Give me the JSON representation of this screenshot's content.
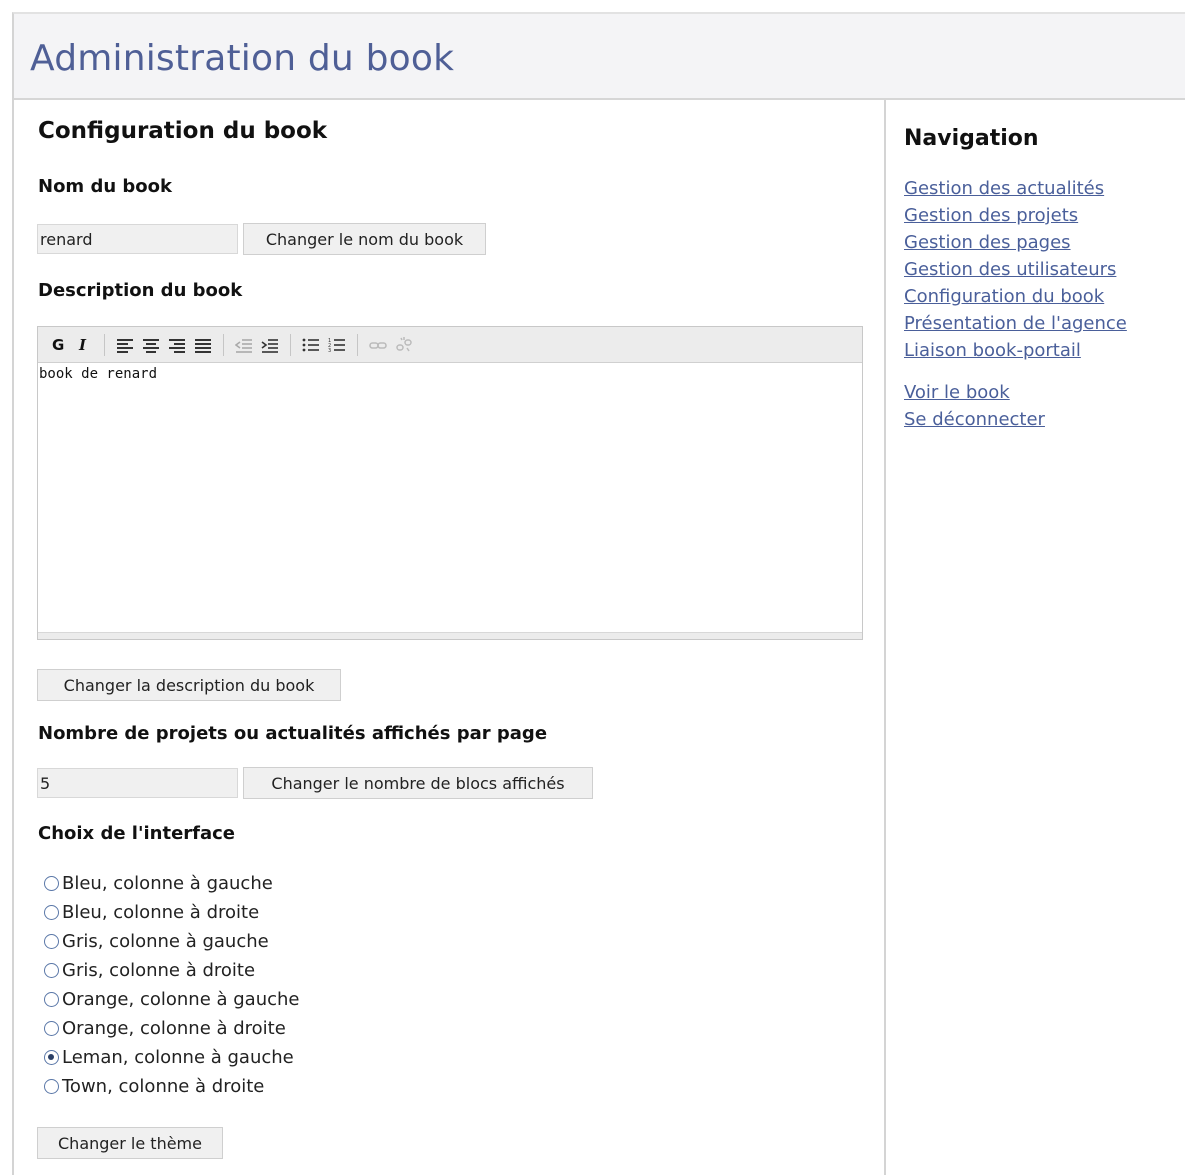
{
  "page": {
    "title": "Administration du book"
  },
  "main": {
    "section_title": "Configuration du book",
    "name": {
      "label": "Nom du book",
      "value": "renard",
      "button": "Changer le nom du book"
    },
    "description": {
      "label": "Description du book",
      "content": "book de renard",
      "button": "Changer la description du book",
      "toolbar": [
        "bold-icon",
        "italic-icon",
        "align-left-icon",
        "align-center-icon",
        "align-right-icon",
        "align-justify-icon",
        "outdent-icon",
        "indent-icon",
        "bullet-list-icon",
        "numbered-list-icon",
        "link-icon",
        "unlink-icon"
      ]
    },
    "count": {
      "label": "Nombre de projets ou actualités affichés par page",
      "value": "5",
      "button": "Changer le nombre de blocs affichés"
    },
    "theme": {
      "label": "Choix de l'interface",
      "options": [
        "Bleu, colonne à gauche",
        "Bleu, colonne à droite",
        "Gris, colonne à gauche",
        "Gris, colonne à droite",
        "Orange, colonne à gauche",
        "Orange, colonne à droite",
        "Leman, colonne à gauche",
        "Town, colonne à droite"
      ],
      "selected_index": 6,
      "button": "Changer le thème"
    }
  },
  "sidebar": {
    "title": "Navigation",
    "links": [
      "Gestion des actualités",
      "Gestion des projets",
      "Gestion des pages",
      "Gestion des utilisateurs",
      "Configuration du book",
      "Présentation de l'agence",
      "Liaison book-portail"
    ],
    "links2": [
      "Voir le book",
      "Se déconnecter"
    ]
  },
  "colors": {
    "title": "#4f5f96",
    "link": "#4a5f9a",
    "header_bg": "#f4f4f6"
  }
}
